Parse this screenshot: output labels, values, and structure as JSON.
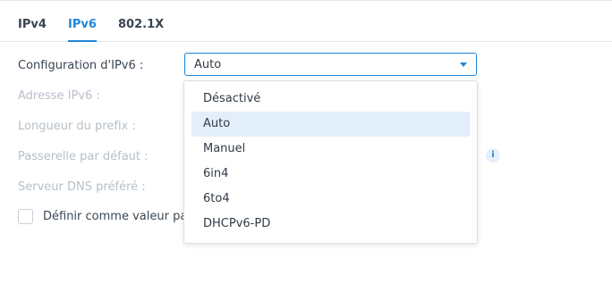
{
  "tabs": [
    "IPv4",
    "IPv6",
    "802.1X"
  ],
  "active_tab": "IPv6",
  "form": {
    "config_label": "Configuration d'IPv6 :",
    "config_value": "Auto",
    "address_label": "Adresse IPv6 :",
    "prefix_label": "Longueur du prefix :",
    "gateway_label": "Passerelle par défaut :",
    "dns_label": "Serveur DNS préféré :",
    "default_checkbox_label": "Définir comme valeur pa"
  },
  "dropdown": {
    "options": [
      "Désactivé",
      "Auto",
      "Manuel",
      "6in4",
      "6to4",
      "DHCPv6-PD"
    ],
    "selected": "Auto"
  },
  "icons": {
    "caret": "chevron-down-icon",
    "info": "info-icon"
  },
  "colors": {
    "accent": "#1f86d9",
    "disabled_text": "#b7bfc8",
    "selected_option_bg": "#e3eefb"
  }
}
